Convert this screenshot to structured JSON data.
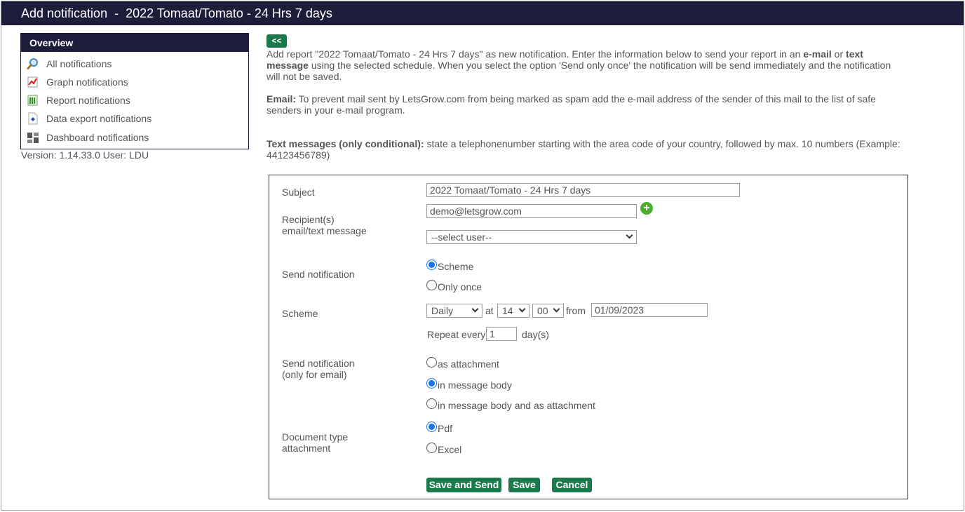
{
  "title": "Add notification  -  2022 Tomaat/Tomato - 24 Hrs 7 days",
  "sidebar": {
    "header": "Overview",
    "items": [
      {
        "label": "All notifications",
        "icon": "magnifier-icon"
      },
      {
        "label": "Graph notifications",
        "icon": "graph-icon"
      },
      {
        "label": "Report notifications",
        "icon": "report-icon"
      },
      {
        "label": "Data export notifications",
        "icon": "data-export-icon"
      },
      {
        "label": "Dashboard notifications",
        "icon": "dashboard-icon"
      }
    ],
    "version": "Version: 1.14.33.0 User: LDU"
  },
  "back_button": "<<",
  "intro": {
    "p1_a": "Add report \"2022 Tomaat/Tomato - 24 Hrs 7 days\" as new notification. Enter the information below to send your report in an ",
    "p1_b": "e-mail",
    "p1_c": " or ",
    "p1_d": "text message",
    "p1_e": " using the selected schedule. When you select the option 'Send only once' the notification will be send immediately and the notification will not be saved.",
    "email_label": "Email:",
    "email_text": " To prevent mail sent by LetsGrow.com from being marked as spam add the e-mail address of the sender of this mail to the list of safe senders in your e-mail program.",
    "sms_label": "Text messages (only conditional):",
    "sms_text": " state a telephonenumber starting with the area code of your country, followed by max. 10 numbers (Example: 44123456789)"
  },
  "form": {
    "subject_label": "Subject",
    "subject_value": "2022 Tomaat/Tomato - 24 Hrs 7 days",
    "recipients_label_1": "Recipient(s)",
    "recipients_label_2": "email/text message",
    "recipient_value": "demo@letsgrow.com",
    "select_user": "--select user--",
    "send_label": "Send notification",
    "send_options": [
      "Scheme",
      "Only once"
    ],
    "send_selected": 0,
    "scheme_label": "Scheme",
    "frequency": "Daily",
    "at_label": "at",
    "hour": "14",
    "minute": "00",
    "from_label": "from",
    "from_date": "01/09/2023",
    "repeat_label": "Repeat every",
    "repeat_value": "1",
    "repeat_unit": "day(s)",
    "format_label_1": "Send notification",
    "format_label_2": "(only for email)",
    "format_options": [
      "as attachment",
      "in message body",
      "in message body and as attachment"
    ],
    "format_selected": 1,
    "doctype_label_1": "Document type",
    "doctype_label_2": "attachment",
    "doctype_options": [
      "Pdf",
      "Excel"
    ],
    "doctype_selected": 0
  },
  "buttons": {
    "save_and_send": "Save and Send",
    "save": "Save",
    "cancel": "Cancel"
  },
  "colors": {
    "header_bg": "#1d1c3b",
    "button_green": "#1a7a4c",
    "radio_blue": "#1a73e8",
    "add_green": "#4caf2f"
  }
}
